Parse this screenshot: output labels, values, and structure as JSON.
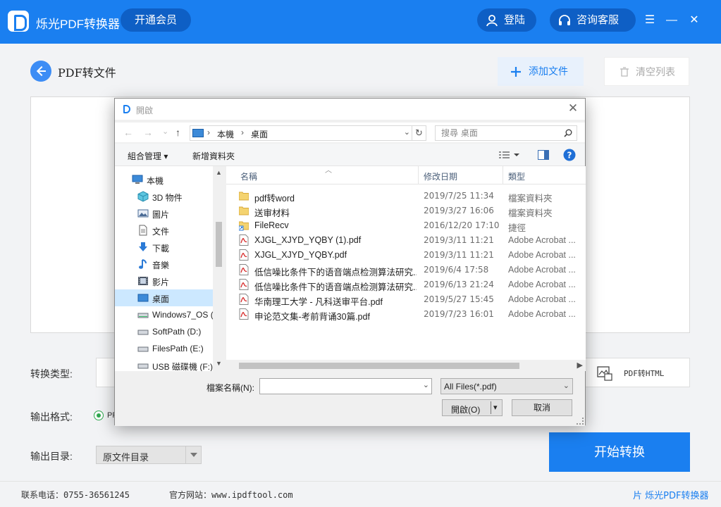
{
  "app": {
    "title": "烁光PDF转换器",
    "vip_label": "开通会员",
    "login_label": "登陆",
    "service_label": "咨询客服",
    "menu_glyph": "☰",
    "minimize_glyph": "—",
    "close_glyph": "✕"
  },
  "main": {
    "page_title": "PDF转文件",
    "add_file_label": "添加文件",
    "clear_list_label": "清空列表",
    "convert_type_label": "转换类型:",
    "convert_type_option": "PDF转HTML",
    "output_format_label": "输出格式:",
    "output_format_value": "PF",
    "output_dir_label": "输出目录:",
    "output_dir_value": "原文件目录",
    "start_label": "开始转换"
  },
  "footer": {
    "phone": "联系电话：0755-36561245",
    "site": "官方网站：www.ipdftool.com",
    "brand": "片 烁光PDF转换器"
  },
  "dialog": {
    "title": "開啟",
    "close_glyph": "✕",
    "nav": {
      "back": "←",
      "forward": "→",
      "recent": "⌄",
      "up": "↑"
    },
    "address": [
      "本機",
      "桌面"
    ],
    "address_sep": "›",
    "search_placeholder": "搜尋 桌面",
    "toolbar": {
      "organize": "組合管理 ▾",
      "new_folder": "新增資料夾",
      "help": "?"
    },
    "tree": [
      {
        "label": "本機",
        "icon": "pc-icon"
      },
      {
        "label": "3D 物件",
        "icon": "cube-icon"
      },
      {
        "label": "圖片",
        "icon": "pictures-icon"
      },
      {
        "label": "文件",
        "icon": "documents-icon"
      },
      {
        "label": "下載",
        "icon": "download-icon"
      },
      {
        "label": "音樂",
        "icon": "music-icon"
      },
      {
        "label": "影片",
        "icon": "video-icon"
      },
      {
        "label": "桌面",
        "icon": "desktop-icon"
      },
      {
        "label": "Windows7_OS (",
        "icon": "drive-icon"
      },
      {
        "label": "SoftPath (D:)",
        "icon": "drive-icon"
      },
      {
        "label": "FilesPath (E:)",
        "icon": "drive-icon"
      },
      {
        "label": "USB 磁碟機 (F:)",
        "icon": "usb-drive-icon"
      }
    ],
    "columns": {
      "name": "名稱",
      "modified": "修改日期",
      "type": "類型"
    },
    "files": [
      {
        "name": "pdf转word",
        "modified": "2019/7/25 11:34",
        "type": "檔案資料夾",
        "kind": "folder"
      },
      {
        "name": "送审材料",
        "modified": "2019/3/27 16:06",
        "type": "檔案資料夾",
        "kind": "folder"
      },
      {
        "name": "FileRecv",
        "modified": "2016/12/20 17:10",
        "type": "捷徑",
        "kind": "shortcut"
      },
      {
        "name": "XJGL_XJYD_YQBY (1).pdf",
        "modified": "2019/3/11 11:21",
        "type": "Adobe Acrobat ...",
        "kind": "pdf"
      },
      {
        "name": "XJGL_XJYD_YQBY.pdf",
        "modified": "2019/3/11 11:21",
        "type": "Adobe Acrobat ...",
        "kind": "pdf"
      },
      {
        "name": "低信噪比条件下的语音端点检测算法研究...",
        "modified": "2019/6/4 17:58",
        "type": "Adobe Acrobat ...",
        "kind": "pdf"
      },
      {
        "name": "低信噪比条件下的语音端点检测算法研究...",
        "modified": "2019/6/13 21:24",
        "type": "Adobe Acrobat ...",
        "kind": "pdf"
      },
      {
        "name": "华南理工大学 - 凡科送审平台.pdf",
        "modified": "2019/5/27 15:45",
        "type": "Adobe Acrobat ...",
        "kind": "pdf"
      },
      {
        "name": "申论范文集-考前背诵30篇.pdf",
        "modified": "2019/7/23 16:01",
        "type": "Adobe Acrobat ...",
        "kind": "pdf"
      }
    ],
    "filename_label": "檔案名稱(N):",
    "filename_value": "",
    "filetype_value": "All Files(*.pdf)",
    "open_label": "開啟(O)",
    "cancel_label": "取消"
  },
  "colors": {
    "accent": "#1a7ff0",
    "dark_accent": "#0e5fc5",
    "selection": "#cce8ff"
  }
}
